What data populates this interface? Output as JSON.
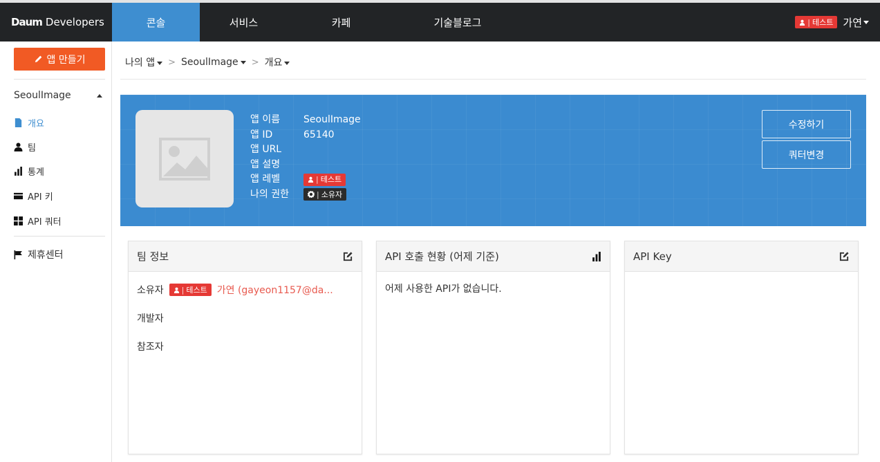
{
  "nav": {
    "brand_logo": "Daum",
    "brand_text": "Developers",
    "tabs": [
      "콘솔",
      "서비스",
      "카페",
      "기술블로그"
    ],
    "active_tab": "콘솔",
    "badge": "테스트",
    "user": "가연"
  },
  "sidebar": {
    "create_button": "앱 만들기",
    "app_name": "SeoulImage",
    "items": [
      {
        "label": "개요",
        "icon": "document-icon",
        "active": true
      },
      {
        "label": "팀",
        "icon": "user-icon",
        "active": false
      },
      {
        "label": "통계",
        "icon": "bar-chart-icon",
        "active": false
      },
      {
        "label": "API 키",
        "icon": "card-icon",
        "active": false
      },
      {
        "label": "API 쿼터",
        "icon": "grid-icon",
        "active": false
      }
    ],
    "partner": "제휴센터"
  },
  "breadcrumb": [
    "나의 앱",
    "SeoulImage",
    "개요"
  ],
  "app": {
    "labels": {
      "name": "앱 이름",
      "id": "앱 ID",
      "url": "앱 URL",
      "desc": "앱 설명",
      "level": "앱 레벨",
      "role": "나의 권한"
    },
    "name": "SeoulImage",
    "id": "65140",
    "level_badge": "테스트",
    "role_badge": "소유자",
    "edit_button": "수정하기",
    "quota_button": "쿼터변경"
  },
  "panels": {
    "team": {
      "title": "팀 정보",
      "owner_label": "소유자",
      "owner_badge": "테스트",
      "owner_value": "가연 (gayeon1157@da...",
      "developer_label": "개발자",
      "viewer_label": "참조자"
    },
    "api_usage": {
      "title": "API 호출 현황 (어제 기준)",
      "empty_message": "어제 사용한 API가 없습니다."
    },
    "api_key": {
      "title": "API Key"
    }
  },
  "colors": {
    "nav_bg": "#222426",
    "accent_blue": "#3e8ed0",
    "create_orange": "#f15a24",
    "badge_red": "#e53935"
  }
}
